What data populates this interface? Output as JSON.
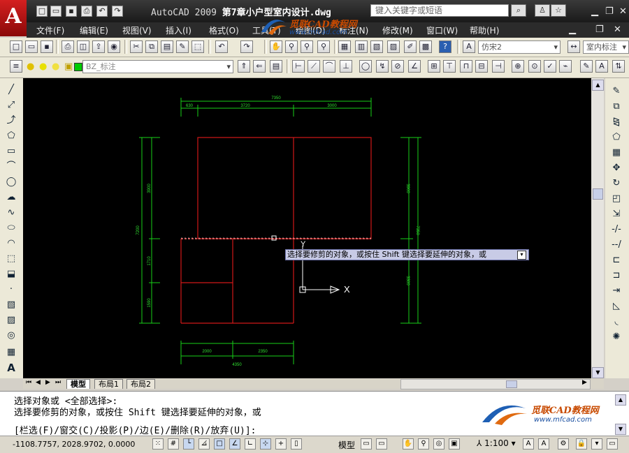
{
  "app": {
    "logo": "A",
    "name": "AutoCAD  2009",
    "file": "第7章小户型室内设计.dwg"
  },
  "search": {
    "placeholder": "键入关键字或短语"
  },
  "menu": [
    "文件(F)",
    "编辑(E)",
    "视图(V)",
    "插入(I)",
    "格式(O)",
    "工具(T)",
    "绘图(D)",
    "标注(N)",
    "修改(M)",
    "窗口(W)",
    "帮助(H)"
  ],
  "toolbar": {
    "text_style": "仿宋2",
    "dim_style": "室内标注",
    "layer": "BZ_标注"
  },
  "drawing": {
    "top_total": "7350",
    "top_parts": [
      "630",
      "3720",
      "3000"
    ],
    "bottom_parts": [
      "2000",
      "2350"
    ],
    "bottom_total": "4350",
    "left_total": "7200",
    "left_parts": [
      "3900",
      "1710",
      "1590"
    ],
    "right_parts": [
      "3900",
      "3300"
    ],
    "right_total": "7350",
    "axis_y": "Y",
    "axis_x": "X"
  },
  "tooltip": "选择要修剪的对象，或按住 Shift 键选择要延伸的对象，或",
  "layout_tabs": [
    "模型",
    "布局1",
    "布局2"
  ],
  "command": {
    "line1": "选择对象或 <全部选择>:",
    "line2": "选择要修剪的对象，或按住 Shift 键选择要延伸的对象，或",
    "line3": "[栏选(F)/窗交(C)/投影(P)/边(E)/删除(R)/放弃(U)]:"
  },
  "status": {
    "coords": "-1108.7757, 2028.9702, 0.0000",
    "model": "模型",
    "scale": "1:100"
  },
  "watermark": {
    "brand": "觅联CAD教程网",
    "url": "www.mfcad.com"
  },
  "colors": {
    "canvas": "#000000",
    "walls": "#d01818",
    "dims": "#18d018",
    "dims_text": "#30e030"
  }
}
